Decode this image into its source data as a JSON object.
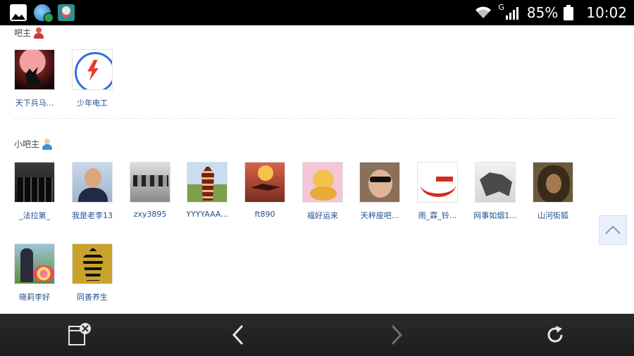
{
  "status_bar": {
    "network_type": "G",
    "battery_percent": "85%",
    "time": "10:02"
  },
  "owners": {
    "title": "吧主",
    "members": [
      {
        "name": "天下兵马..."
      },
      {
        "name": "少年电工"
      }
    ]
  },
  "sub_owners": {
    "title": "小吧主",
    "members": [
      {
        "name": "_法拉第_"
      },
      {
        "name": "我是老李13"
      },
      {
        "name": "zxy3895"
      },
      {
        "name": "YYYYAAA..."
      },
      {
        "name": "ft890"
      },
      {
        "name": "福好运来"
      },
      {
        "name": "天秤座吧..."
      },
      {
        "name": "雨_霖_铃..."
      },
      {
        "name": "网事如烟1..."
      },
      {
        "name": "山河街狐"
      },
      {
        "name": "晓莉李好"
      },
      {
        "name": "同善养生"
      }
    ]
  },
  "colors": {
    "link": "#1f4f8f",
    "toolbar": "#2b2b2b",
    "back_to_top_bg": "#e9f0fb"
  },
  "icons": {
    "back_to_top": "chevron-up-icon",
    "close_tab": "close-window-icon",
    "back": "chevron-left-icon",
    "forward": "chevron-right-icon",
    "refresh": "refresh-icon"
  }
}
